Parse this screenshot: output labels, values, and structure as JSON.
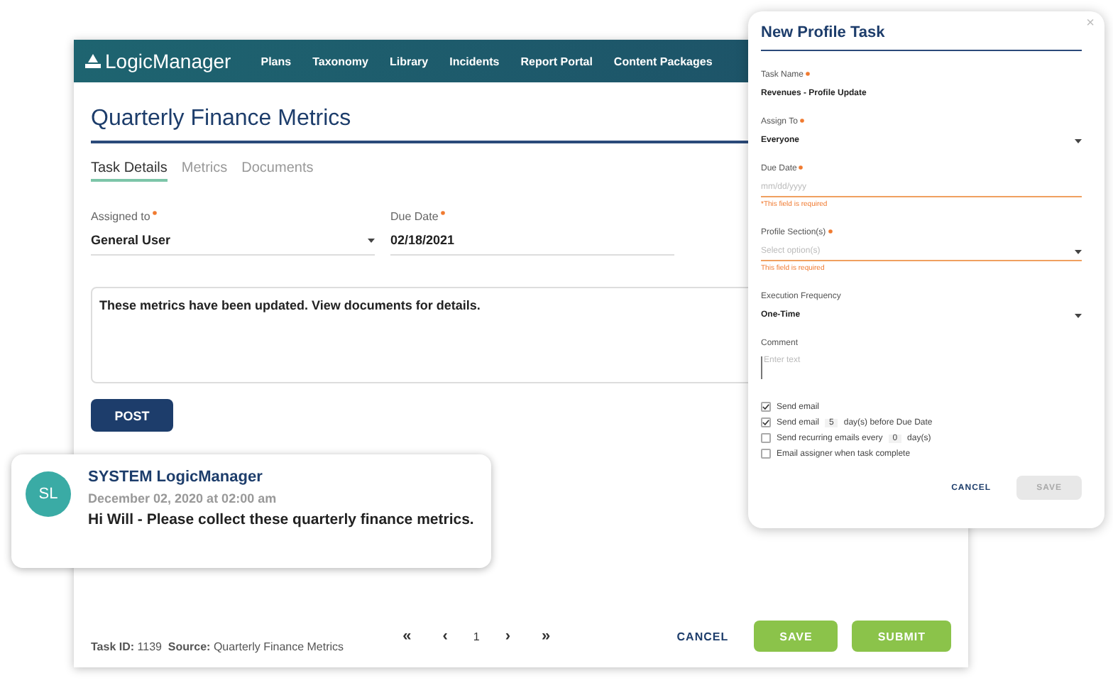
{
  "app": {
    "logo": "LogicManager",
    "nav": [
      "Plans",
      "Taxonomy",
      "Library",
      "Incidents",
      "Report Portal",
      "Content Packages"
    ]
  },
  "task": {
    "title": "Quarterly Finance Metrics",
    "tabs": [
      {
        "label": "Task Details",
        "selected": true
      },
      {
        "label": "Metrics",
        "selected": false
      },
      {
        "label": "Documents",
        "selected": false
      }
    ],
    "fields": [
      {
        "label": "Assigned to",
        "required": true,
        "value": "General User",
        "kind": "select"
      },
      {
        "label": "Due Date",
        "required": true,
        "value": "02/18/2021",
        "kind": "text"
      }
    ],
    "comment": "These metrics have been updated.  View documents for details.",
    "post_button": "POST",
    "footer": {
      "task_id_label": "Task ID:",
      "task_id": "1139",
      "source_label": "Source:",
      "source": "Quarterly Finance Metrics"
    },
    "pager": {
      "first": "«",
      "prev": "‹",
      "page": "1",
      "next": "›",
      "last": "»"
    },
    "buttons": [
      {
        "label": "CANCEL",
        "kind": "text"
      },
      {
        "label": "SAVE",
        "kind": "primary"
      },
      {
        "label": "SUBMIT",
        "kind": "primary"
      }
    ]
  },
  "message": {
    "initials": "SL",
    "author": "SYSTEM LogicManager",
    "date": "December 02, 2020 at 02:00 am",
    "text": "Hi Will - Please collect these quarterly finance metrics."
  },
  "modal": {
    "title": "New Profile Task",
    "close": "×",
    "fields": [
      {
        "label": "Task Name",
        "required": true,
        "kind": "text",
        "value": "Revenues - Profile Update"
      },
      {
        "label": "Assign To",
        "required": true,
        "kind": "select",
        "value": "Everyone"
      },
      {
        "label": "Due Date",
        "required": true,
        "kind": "date",
        "placeholder": "mm/dd/yyyy",
        "error": "*This field is required"
      },
      {
        "label": "Profile Section(s)",
        "required": true,
        "kind": "select",
        "placeholder": "Select option(s)",
        "error": "This field is required"
      },
      {
        "label": "Execution Frequency",
        "required": false,
        "kind": "select",
        "value": "One-Time"
      },
      {
        "label": "Comment",
        "required": false,
        "kind": "textarea",
        "placeholder": "Enter text"
      }
    ],
    "options": [
      {
        "label": "Send email",
        "checked": true
      },
      {
        "label": "Send email",
        "checked": true,
        "value": "5",
        "suffix": "day(s) before Due Date"
      },
      {
        "label": "Send recurring emails every",
        "checked": false,
        "value": "0",
        "suffix": "day(s)"
      },
      {
        "label": "Email assigner when task complete",
        "checked": false
      }
    ],
    "buttons": [
      {
        "label": "CANCEL",
        "kind": "text",
        "disabled": false
      },
      {
        "label": "SAVE",
        "kind": "primary",
        "disabled": true
      }
    ]
  }
}
